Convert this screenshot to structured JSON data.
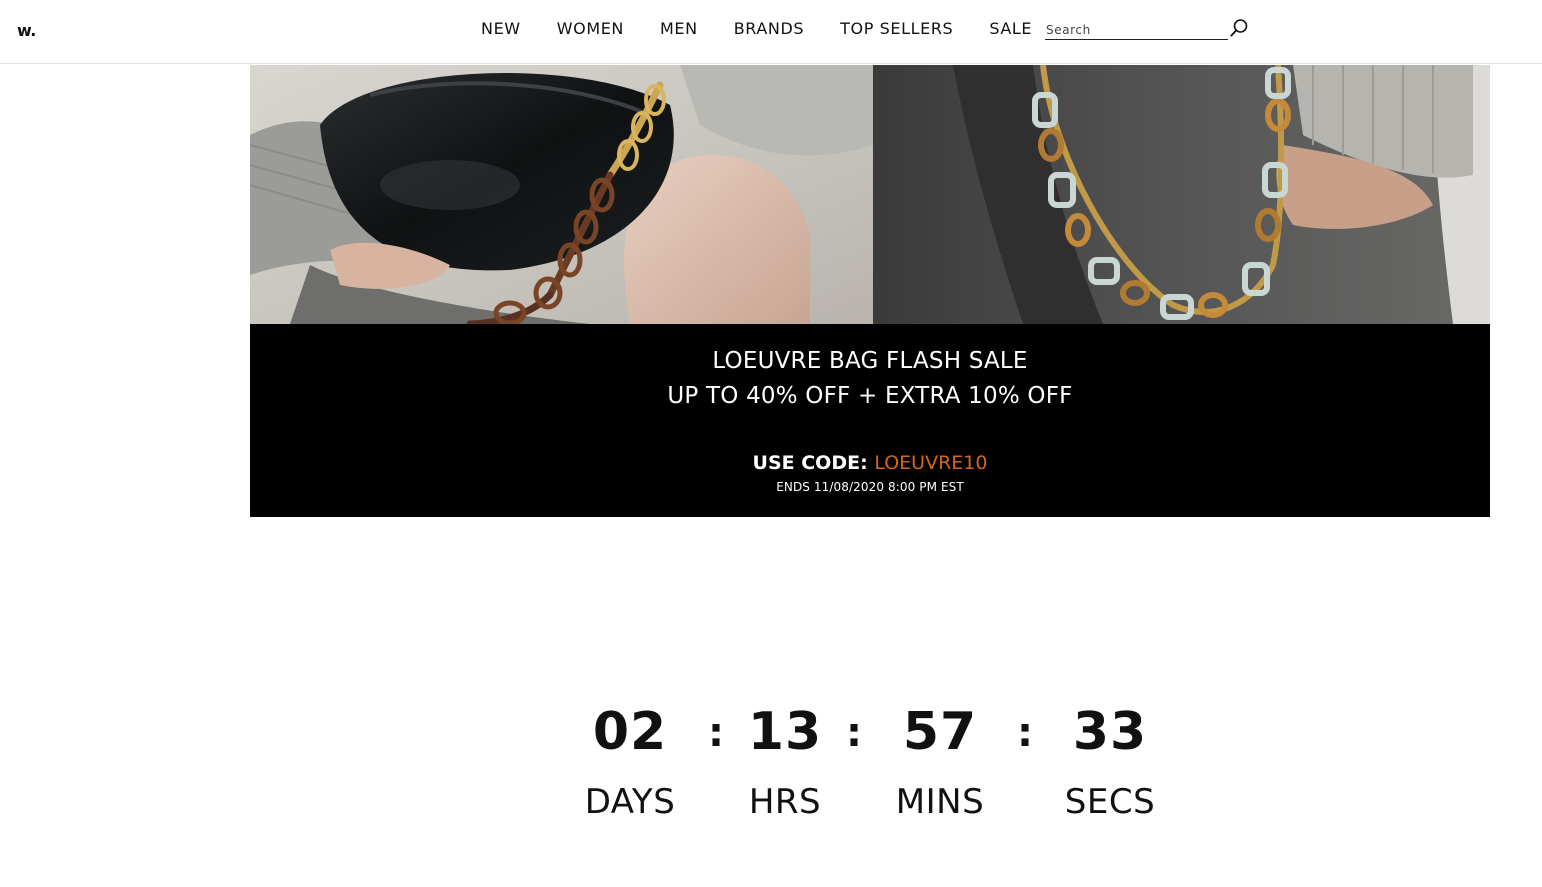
{
  "header": {
    "logo": "w.",
    "nav": [
      {
        "label": "NEW"
      },
      {
        "label": "WOMEN"
      },
      {
        "label": "MEN"
      },
      {
        "label": "BRANDS"
      },
      {
        "label": "TOP SELLERS"
      },
      {
        "label": "SALE"
      }
    ],
    "search": {
      "placeholder": "Search",
      "value": ""
    },
    "search_icon": "magnifier-icon"
  },
  "hero": {
    "left_image": "black-bag-tortoise-chain-photo",
    "right_image": "grey-coat-chain-strap-photo"
  },
  "promo": {
    "line1": "LOEUVRE BAG FLASH SALE",
    "line2": "UP TO 40% OFF + EXTRA 10% OFF",
    "code_prefix": "USE CODE:",
    "code": "LOEUVRE10",
    "ends": "ENDS 11/08/2020 8:00 PM EST",
    "code_color": "#d4661b"
  },
  "countdown": {
    "separator": ":",
    "units": [
      {
        "value": "02",
        "label": "DAYS"
      },
      {
        "value": "13",
        "label": "HRS"
      },
      {
        "value": "57",
        "label": "MINS"
      },
      {
        "value": "33",
        "label": "SECS"
      }
    ]
  }
}
